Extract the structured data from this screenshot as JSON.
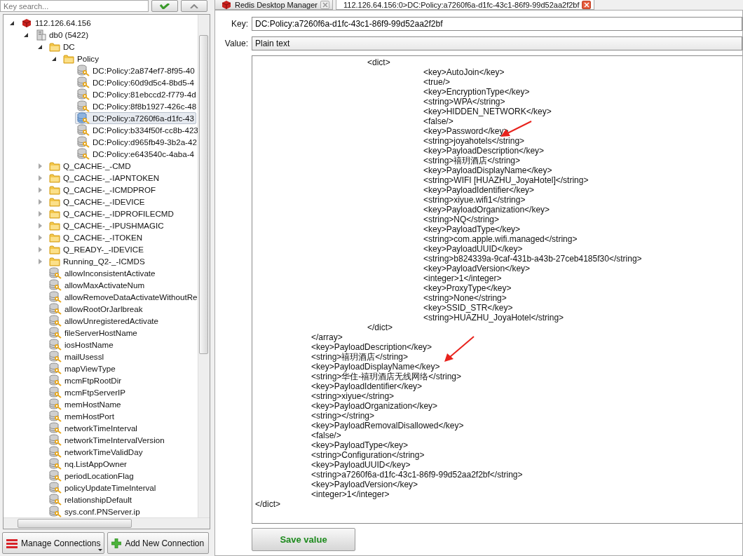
{
  "search": {
    "placeholder": "Key search..."
  },
  "tabs": [
    {
      "label": "Redis Desktop Manager",
      "selected": false
    },
    {
      "label": "112.126.64.156:0>DC:Policy:a7260f6a-d1fc-43c1-86f9-99d52aa2f2bf",
      "selected": true
    }
  ],
  "tree": [
    {
      "label": "112.126.64.156",
      "kind": "server",
      "expanded": true,
      "selected": false,
      "children": [
        {
          "label": "db0 (5422)",
          "kind": "database",
          "expanded": true,
          "selected": false,
          "children": [
            {
              "label": "DC",
              "kind": "folder",
              "expanded": true,
              "selected": false,
              "children": [
                {
                  "label": "Policy",
                  "kind": "folder",
                  "expanded": true,
                  "selected": false,
                  "children": [
                    {
                      "label": "DC:Policy:2a874ef7-8f95-40",
                      "kind": "key",
                      "selected": false
                    },
                    {
                      "label": "DC:Policy:60d9d5c4-8bd5-4",
                      "kind": "key",
                      "selected": false
                    },
                    {
                      "label": "DC:Policy:81ebccd2-f779-4d",
                      "kind": "key",
                      "selected": false
                    },
                    {
                      "label": "DC:Policy:8f8b1927-426c-48",
                      "kind": "key",
                      "selected": false
                    },
                    {
                      "label": "DC:Policy:a7260f6a-d1fc-43",
                      "kind": "key",
                      "selected": true
                    },
                    {
                      "label": "DC:Policy:b334f50f-cc8b-423",
                      "kind": "key",
                      "selected": false
                    },
                    {
                      "label": "DC:Policy:d965fb49-3b2a-42",
                      "kind": "key",
                      "selected": false
                    },
                    {
                      "label": "DC:Policy:e643540c-4aba-4",
                      "kind": "key",
                      "selected": false
                    }
                  ]
                }
              ]
            },
            {
              "label": "Q_CACHE-_-CMD",
              "kind": "folder",
              "expanded": false,
              "selected": false
            },
            {
              "label": "Q_CACHE-_-IAPNTOKEN",
              "kind": "folder",
              "expanded": false,
              "selected": false
            },
            {
              "label": "Q_CACHE-_-ICMDPROF",
              "kind": "folder",
              "expanded": false,
              "selected": false
            },
            {
              "label": "Q_CACHE-_-IDEVICE",
              "kind": "folder",
              "expanded": false,
              "selected": false
            },
            {
              "label": "Q_CACHE-_-IDPROFILECMD",
              "kind": "folder",
              "expanded": false,
              "selected": false
            },
            {
              "label": "Q_CACHE-_-IPUSHMAGIC",
              "kind": "folder",
              "expanded": false,
              "selected": false
            },
            {
              "label": "Q_CACHE-_-ITOKEN",
              "kind": "folder",
              "expanded": false,
              "selected": false
            },
            {
              "label": "Q_READY-_-IDEVICE",
              "kind": "folder",
              "expanded": false,
              "selected": false
            },
            {
              "label": "Running_Q2-_-ICMDS",
              "kind": "folder",
              "expanded": false,
              "selected": false
            },
            {
              "label": "allowInconsistentActivate",
              "kind": "key",
              "selected": false
            },
            {
              "label": "allowMaxActivateNum",
              "kind": "key",
              "selected": false
            },
            {
              "label": "allowRemoveDataActivateWithoutRe",
              "kind": "key",
              "selected": false
            },
            {
              "label": "allowRootOrJarlbreak",
              "kind": "key",
              "selected": false
            },
            {
              "label": "allowUnregisteredActivate",
              "kind": "key",
              "selected": false
            },
            {
              "label": "fileServerHostName",
              "kind": "key",
              "selected": false
            },
            {
              "label": "iosHostName",
              "kind": "key",
              "selected": false
            },
            {
              "label": "mailUsessl",
              "kind": "key",
              "selected": false
            },
            {
              "label": "mapViewType",
              "kind": "key",
              "selected": false
            },
            {
              "label": "mcmFtpRootDir",
              "kind": "key",
              "selected": false
            },
            {
              "label": "mcmFtpServerIP",
              "kind": "key",
              "selected": false
            },
            {
              "label": "memHostName",
              "kind": "key",
              "selected": false
            },
            {
              "label": "memHostPort",
              "kind": "key",
              "selected": false
            },
            {
              "label": "networkTimeInterval",
              "kind": "key",
              "selected": false
            },
            {
              "label": "networkTimeIntervalVersion",
              "kind": "key",
              "selected": false
            },
            {
              "label": "networkTimeValidDay",
              "kind": "key",
              "selected": false
            },
            {
              "label": "nq.ListAppOwner",
              "kind": "key",
              "selected": false
            },
            {
              "label": "periodLocationFlag",
              "kind": "key",
              "selected": false
            },
            {
              "label": "policyUpdateTimeInterval",
              "kind": "key",
              "selected": false
            },
            {
              "label": "relationshipDefault",
              "kind": "key",
              "selected": false
            },
            {
              "label": "sys.conf.PNServer.ip",
              "kind": "key",
              "selected": false
            }
          ]
        }
      ]
    }
  ],
  "key_field": {
    "label": "Key:",
    "value": "DC:Policy:a7260f6a-d1fc-43c1-86f9-99d52aa2f2bf"
  },
  "value_format": {
    "label": "Value:",
    "value": "Plain text"
  },
  "value_lines": [
    "\t\t<dict>",
    "\t\t\t<key>AutoJoin</key>",
    "\t\t\t<true/>",
    "\t\t\t<key>EncryptionType</key>",
    "\t\t\t<string>WPA</string>",
    "\t\t\t<key>HIDDEN_NETWORK</key>",
    "\t\t\t<false/>",
    "\t\t\t<key>Password</key>",
    "\t\t\t<string>joyahotels</string>",
    "\t\t\t<key>PayloadDescription</key>",
    "\t\t\t<string>禧玥酒店</string>",
    "\t\t\t<key>PayloadDisplayName</key>",
    "\t\t\t<string>WIFI [HUAZHU_JoyaHotel]</string>",
    "\t\t\t<key>PayloadIdentifier</key>",
    "\t\t\t<string>xiyue.wifi1</string>",
    "\t\t\t<key>PayloadOrganization</key>",
    "\t\t\t<string>NQ</string>",
    "\t\t\t<key>PayloadType</key>",
    "\t\t\t<string>com.apple.wifi.managed</string>",
    "\t\t\t<key>PayloadUUID</key>",
    "\t\t\t<string>b824339a-9caf-431b-a43b-27ceb4185f30</string>",
    "\t\t\t<key>PayloadVersion</key>",
    "\t\t\t<integer>1</integer>",
    "\t\t\t<key>ProxyType</key>",
    "\t\t\t<string>None</string>",
    "\t\t\t<key>SSID_STR</key>",
    "\t\t\t<string>HUAZHU_JoyaHotel</string>",
    "\t\t</dict>",
    "\t</array>",
    "\t<key>PayloadDescription</key>",
    "\t<string>禧玥酒店</string>",
    "\t<key>PayloadDisplayName</key>",
    "\t<string>华住-禧玥酒店无线网络</string>",
    "\t<key>PayloadIdentifier</key>",
    "\t<string>xiyue</string>",
    "\t<key>PayloadOrganization</key>",
    "\t<string></string>",
    "\t<key>PayloadRemovalDisallowed</key>",
    "\t<false/>",
    "\t<key>PayloadType</key>",
    "\t<string>Configuration</string>",
    "\t<key>PayloadUUID</key>",
    "\t<string>a7260f6a-d1fc-43c1-86f9-99d52aa2f2bf</string>",
    "\t<key>PayloadVersion</key>",
    "\t<integer>1</integer>",
    "</dict>"
  ],
  "save_button": "Save value",
  "buttons": [
    {
      "label": "Manage Connections",
      "kind": "menu"
    },
    {
      "label": "Add New Connection",
      "kind": "add"
    }
  ]
}
